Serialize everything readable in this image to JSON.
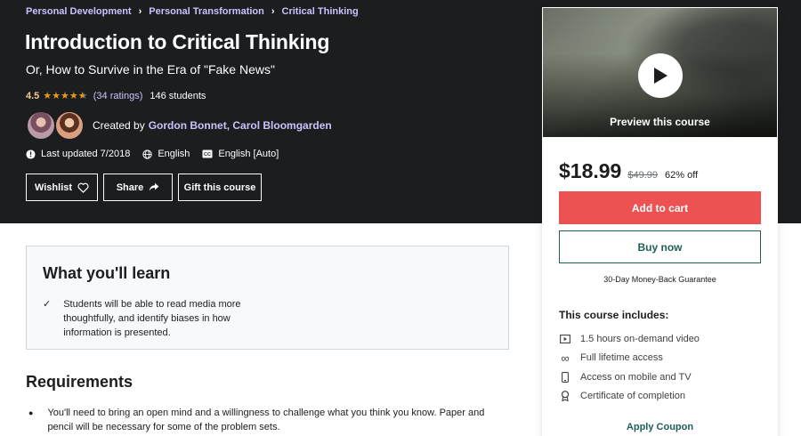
{
  "breadcrumb": [
    "Personal Development",
    "Personal Transformation",
    "Critical Thinking"
  ],
  "course": {
    "title": "Introduction to Critical Thinking",
    "subtitle": "Or, How to Survive in the Era of \"Fake News\"",
    "rating": "4.5",
    "stars_icon": "star-rating-icon",
    "stars_value": 4.5,
    "ratings_count": "(34 ratings)",
    "students": "146 students",
    "created_by_label": "Created by",
    "instructors": "Gordon Bonnet, Carol Bloomgarden",
    "last_updated": "Last updated 7/2018",
    "language": "English",
    "captions": "English [Auto]"
  },
  "actions": {
    "wishlist": "Wishlist",
    "share": "Share",
    "gift": "Gift this course"
  },
  "sidebar": {
    "preview_label": "Preview this course",
    "price": "$18.99",
    "original_price": "$49.99",
    "discount": "62% off",
    "add_to_cart": "Add to cart",
    "buy_now": "Buy now",
    "guarantee": "30-Day Money-Back Guarantee",
    "includes_title": "This course includes:",
    "includes": [
      {
        "icon": "video-icon",
        "label": "1.5 hours on-demand video"
      },
      {
        "icon": "infinity-icon",
        "label": "Full lifetime access"
      },
      {
        "icon": "mobile-icon",
        "label": "Access on mobile and TV"
      },
      {
        "icon": "certificate-icon",
        "label": "Certificate of completion"
      }
    ],
    "apply_coupon": "Apply Coupon"
  },
  "learn": {
    "title": "What you'll learn",
    "items": [
      "Students will be able to read media more thoughtfully, and identify biases in how information is presented."
    ]
  },
  "requirements": {
    "title": "Requirements",
    "items": [
      "You'll need to bring an open mind and a willingness to challenge what you think you know. Paper and pencil will be necessary for some of the problem sets."
    ]
  },
  "colors": {
    "hero_bg": "#1c1d1f",
    "link_purple": "#cec0fc",
    "star": "#e59819",
    "cart_red": "#ec5252",
    "teal": "#1e6055"
  }
}
